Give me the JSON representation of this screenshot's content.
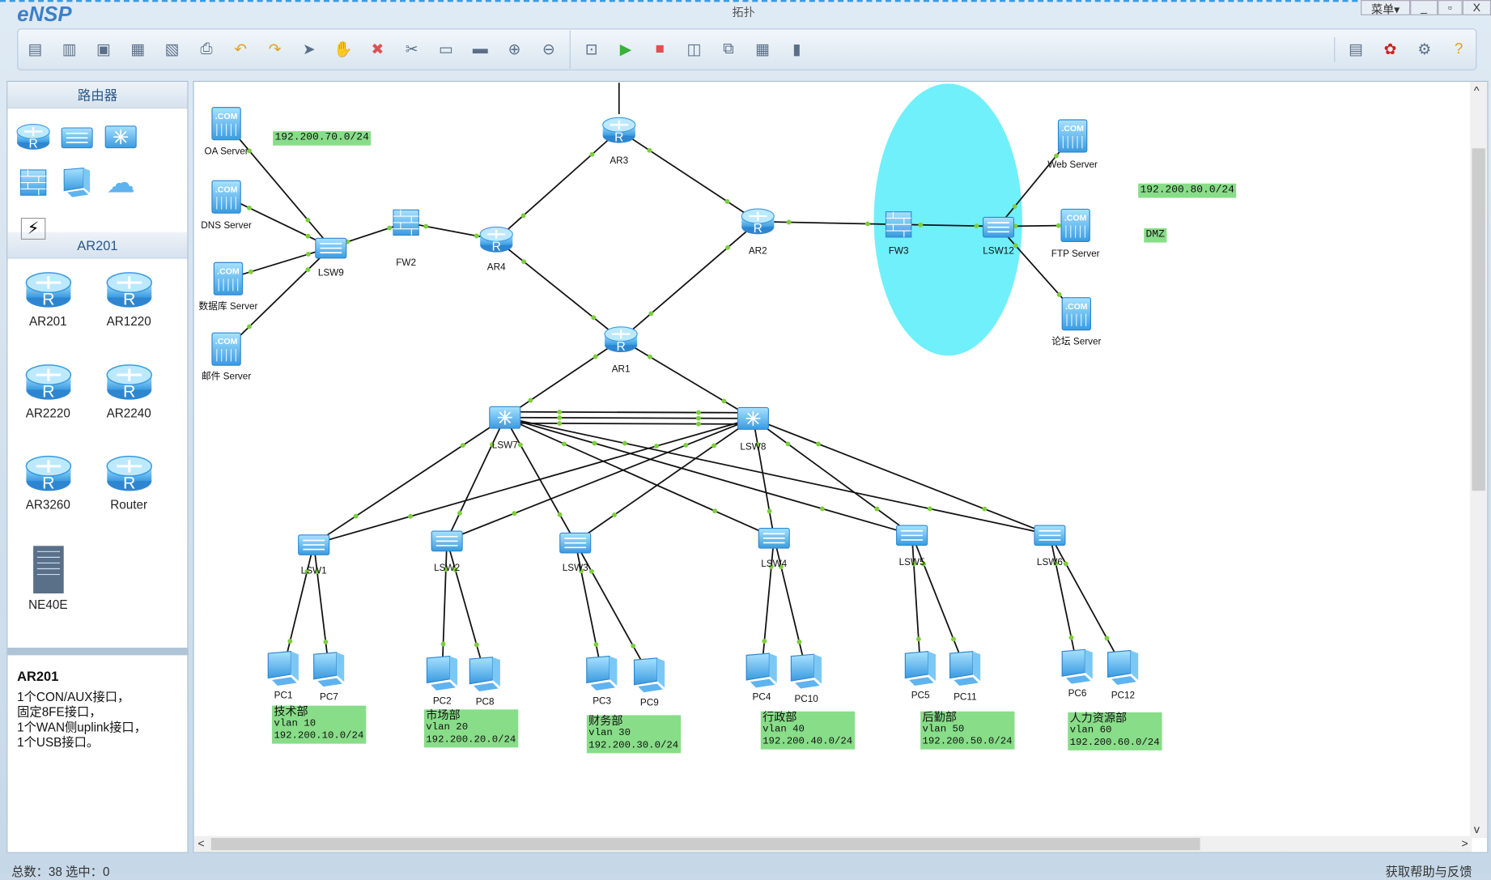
{
  "window": {
    "app_name": "eNSP",
    "title": "拓扑",
    "menu_label": "菜单▾",
    "minimize": "_",
    "restore": "▫",
    "close": "X"
  },
  "toolbar": {
    "left_icons": [
      "new-topology",
      "new-lab",
      "open",
      "save",
      "save-as",
      "print",
      "undo",
      "redo",
      "select",
      "pan",
      "delete",
      "delete-link",
      "text-note",
      "rectangle",
      "zoom-in",
      "zoom-out"
    ],
    "mid_icons": [
      "fit-view",
      "start-device",
      "stop-device",
      "capture",
      "topology-view",
      "grid",
      "console"
    ],
    "right_icons": [
      "chat",
      "huawei",
      "settings",
      "help"
    ]
  },
  "sidebar": {
    "category_title": "路由器",
    "device_types": [
      "router",
      "switch",
      "wireless",
      "firewall",
      "pc",
      "cloud",
      "connection"
    ],
    "model_title": "AR201",
    "models": [
      "AR201",
      "AR1220",
      "AR2220",
      "AR2240",
      "AR3260",
      "Router",
      "NE40E"
    ],
    "info": {
      "title": "AR201",
      "lines": [
        "1个CON/AUX接口，",
        "固定8FE接口，",
        "1个WAN侧uplink接口，",
        "1个USB接口。"
      ]
    }
  },
  "topology": {
    "nodes": [
      {
        "name": "OA Server",
        "type": "server"
      },
      {
        "name": "DNS Server",
        "type": "server"
      },
      {
        "name": "数据库 Server",
        "type": "server"
      },
      {
        "name": "邮件 Server",
        "type": "server"
      },
      {
        "name": "LSW9",
        "type": "switch"
      },
      {
        "name": "FW2",
        "type": "firewall"
      },
      {
        "name": "AR4",
        "type": "router"
      },
      {
        "name": "AR3",
        "type": "router"
      },
      {
        "name": "AR2",
        "type": "router"
      },
      {
        "name": "AR1",
        "type": "router"
      },
      {
        "name": "FW3",
        "type": "firewall"
      },
      {
        "name": "LSW12",
        "type": "switch"
      },
      {
        "name": "Web Server",
        "type": "server"
      },
      {
        "name": "FTP Server",
        "type": "server"
      },
      {
        "name": "论坛 Server",
        "type": "server"
      },
      {
        "name": "LSW7",
        "type": "core-switch"
      },
      {
        "name": "LSW8",
        "type": "core-switch"
      },
      {
        "name": "LSW1",
        "type": "switch"
      },
      {
        "name": "LSW2",
        "type": "switch"
      },
      {
        "name": "LSW3",
        "type": "switch"
      },
      {
        "name": "LSW4",
        "type": "switch"
      },
      {
        "name": "LSW5",
        "type": "switch"
      },
      {
        "name": "LSW6",
        "type": "switch"
      },
      {
        "name": "PC1",
        "type": "pc"
      },
      {
        "name": "PC7",
        "type": "pc"
      },
      {
        "name": "PC2",
        "type": "pc"
      },
      {
        "name": "PC8",
        "type": "pc"
      },
      {
        "name": "PC3",
        "type": "pc"
      },
      {
        "name": "PC9",
        "type": "pc"
      },
      {
        "name": "PC4",
        "type": "pc"
      },
      {
        "name": "PC10",
        "type": "pc"
      },
      {
        "name": "PC5",
        "type": "pc"
      },
      {
        "name": "PC11",
        "type": "pc"
      },
      {
        "name": "PC6",
        "type": "pc"
      },
      {
        "name": "PC12",
        "type": "pc"
      }
    ],
    "links": [
      [
        "LSW9",
        "OA Server"
      ],
      [
        "LSW9",
        "DNS Server"
      ],
      [
        "LSW9",
        "数据库 Server"
      ],
      [
        "LSW9",
        "邮件 Server"
      ],
      [
        "LSW9",
        "FW2"
      ],
      [
        "FW2",
        "AR4"
      ],
      [
        "AR4",
        "AR3"
      ],
      [
        "AR3",
        "AR2"
      ],
      [
        "AR4",
        "AR1"
      ],
      [
        "AR2",
        "AR1"
      ],
      [
        "AR2",
        "FW3"
      ],
      [
        "FW3",
        "LSW12"
      ],
      [
        "LSW12",
        "Web Server"
      ],
      [
        "LSW12",
        "FTP Server"
      ],
      [
        "LSW12",
        "论坛 Server"
      ],
      [
        "AR1",
        "LSW7"
      ],
      [
        "AR1",
        "LSW8"
      ],
      [
        "LSW7",
        "LSW8"
      ],
      [
        "LSW7",
        "LSW8"
      ],
      [
        "LSW7",
        "LSW8"
      ],
      [
        "LSW7",
        "LSW1"
      ],
      [
        "LSW7",
        "LSW2"
      ],
      [
        "LSW7",
        "LSW3"
      ],
      [
        "LSW7",
        "LSW4"
      ],
      [
        "LSW7",
        "LSW5"
      ],
      [
        "LSW7",
        "LSW6"
      ],
      [
        "LSW8",
        "LSW1"
      ],
      [
        "LSW8",
        "LSW2"
      ],
      [
        "LSW8",
        "LSW3"
      ],
      [
        "LSW8",
        "LSW4"
      ],
      [
        "LSW8",
        "LSW5"
      ],
      [
        "LSW8",
        "LSW6"
      ],
      [
        "LSW1",
        "PC1"
      ],
      [
        "LSW1",
        "PC7"
      ],
      [
        "LSW2",
        "PC2"
      ],
      [
        "LSW2",
        "PC8"
      ],
      [
        "LSW3",
        "PC3"
      ],
      [
        "LSW3",
        "PC9"
      ],
      [
        "LSW4",
        "PC4"
      ],
      [
        "LSW4",
        "PC10"
      ],
      [
        "LSW5",
        "PC5"
      ],
      [
        "LSW5",
        "PC11"
      ],
      [
        "LSW6",
        "PC6"
      ],
      [
        "LSW6",
        "PC12"
      ]
    ],
    "dmz_area_color": "#6ff0fb",
    "link_color": "#111111",
    "port_color": "#7ccf3c",
    "labels": {
      "net70": "192.200.70.0/24",
      "net80": "192.200.80.0/24",
      "dmz": "DMZ"
    },
    "departments": [
      {
        "name": "技术部",
        "vlan": "vlan 10",
        "subnet": "192.200.10.0/24"
      },
      {
        "name": "市场部",
        "vlan": "vlan 20",
        "subnet": "192.200.20.0/24"
      },
      {
        "name": "财务部",
        "vlan": "vlan 30",
        "subnet": "192.200.30.0/24"
      },
      {
        "name": "行政部",
        "vlan": "vlan 40",
        "subnet": "192.200.40.0/24"
      },
      {
        "name": "后勤部",
        "vlan": "vlan 50",
        "subnet": "192.200.50.0/24"
      },
      {
        "name": "人力资源部",
        "vlan": "vlan 60",
        "subnet": "192.200.60.0/24"
      }
    ]
  },
  "status": {
    "summary": "总数：38 选中：0",
    "help_link": "获取帮助与反馈"
  }
}
